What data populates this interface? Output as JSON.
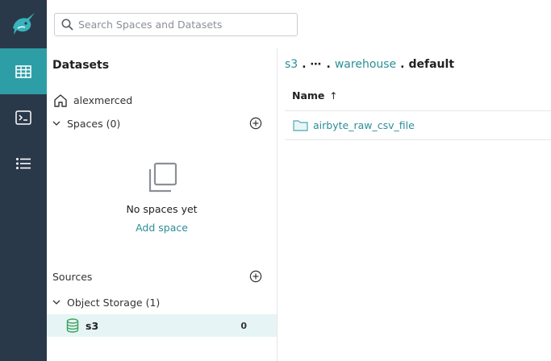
{
  "search": {
    "placeholder": "Search Spaces and Datasets"
  },
  "left_panel": {
    "title": "Datasets",
    "home_label": "alexmerced",
    "spaces_label": "Spaces (0)",
    "empty_text": "No spaces yet",
    "add_space_label": "Add space",
    "sources_label": "Sources",
    "object_storage_label": "Object Storage (1)",
    "source_item": {
      "name": "s3",
      "count": "0"
    }
  },
  "breadcrumb": {
    "root": "s3",
    "more": "⋯",
    "middle": "warehouse",
    "current": "default",
    "separator": "."
  },
  "table": {
    "column_header": "Name",
    "sort_indicator": "↑",
    "rows": [
      {
        "name": "airbyte_raw_csv_file",
        "icon": "folder-icon"
      }
    ]
  },
  "colors": {
    "nav_bg": "#2a394a",
    "accent": "#2e9ea6",
    "link": "#2a8f97",
    "selected_bg": "#e6f4f5"
  }
}
